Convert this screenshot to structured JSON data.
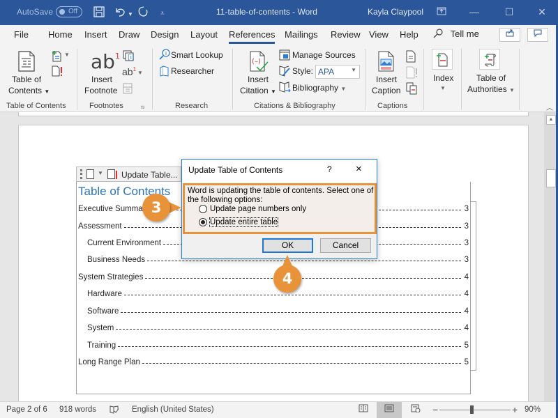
{
  "titlebar": {
    "autosave_label": "AutoSave",
    "autosave_state": "Off",
    "document_title": "11-table-of-contents - Word",
    "user_name": "Kayla Claypool",
    "icons": [
      "save-icon",
      "undo-icon",
      "redo-icon",
      "customize-qat-icon",
      "ribbon-display-icon",
      "minimize-icon",
      "maximize-icon",
      "close-icon"
    ]
  },
  "menu": {
    "tabs": [
      {
        "label": "File"
      },
      {
        "label": "Home"
      },
      {
        "label": "Insert"
      },
      {
        "label": "Draw"
      },
      {
        "label": "Design"
      },
      {
        "label": "Layout"
      },
      {
        "label": "References",
        "active": true
      },
      {
        "label": "Mailings"
      },
      {
        "label": "Review"
      },
      {
        "label": "View"
      },
      {
        "label": "Help"
      }
    ],
    "tell_me": "Tell me",
    "accent_color": "#2b579a"
  },
  "ribbon": {
    "groups": [
      {
        "label": "Table of Contents",
        "buttons": [
          {
            "label_line1": "Table of",
            "label_line2": "Contents",
            "dropdown": true,
            "icon": "table-of-contents-icon"
          },
          {
            "icon": "add-text-icon",
            "dropdown": true
          },
          {
            "icon": "update-table-icon"
          }
        ]
      },
      {
        "label": "Footnotes",
        "buttons": [
          {
            "label_line1": "Insert",
            "label_line2": "Footnote",
            "icon": "insert-footnote-icon"
          },
          {
            "icon": "insert-endnote-icon"
          },
          {
            "icon": "next-footnote-icon",
            "dropdown": true
          },
          {
            "icon": "show-notes-icon",
            "disabled": true
          }
        ]
      },
      {
        "label": "Research",
        "buttons": [
          {
            "label": "Smart Lookup",
            "icon": "smart-lookup-icon"
          },
          {
            "label": "Researcher",
            "icon": "researcher-icon"
          }
        ]
      },
      {
        "label": "Citations & Bibliography",
        "buttons": [
          {
            "label_line1": "Insert",
            "label_line2": "Citation",
            "dropdown": true,
            "icon": "insert-citation-icon"
          },
          {
            "label": "Manage Sources",
            "icon": "manage-sources-icon"
          },
          {
            "label": "Style:",
            "value": "APA",
            "icon": "style-icon"
          },
          {
            "label": "Bibliography",
            "dropdown": true,
            "icon": "bibliography-icon"
          }
        ]
      },
      {
        "label": "Captions",
        "buttons": [
          {
            "label_line1": "Insert",
            "label_line2": "Caption",
            "icon": "insert-caption-icon"
          },
          {
            "icon": "insert-table-of-figures-icon"
          },
          {
            "icon": "update-table-of-figures-icon",
            "disabled": true
          },
          {
            "icon": "cross-reference-icon"
          }
        ]
      },
      {
        "label": "",
        "buttons": [
          {
            "label_line1": "Index",
            "dropdown": true,
            "icon": "index-icon"
          }
        ]
      },
      {
        "label": "",
        "buttons": [
          {
            "label_line1": "Table of",
            "label_line2": "Authorities",
            "dropdown": true,
            "icon": "table-of-authorities-icon"
          }
        ]
      }
    ]
  },
  "document": {
    "toc_toolbar": {
      "update_label": "Update Table..."
    },
    "toc_title": "Table of Contents",
    "entries": [
      {
        "text": "Executive Summary",
        "visible_text": "Executive Summa",
        "page": "3",
        "level": 1
      },
      {
        "text": "Assessment",
        "page": "3",
        "level": 1
      },
      {
        "text": "Current Environment",
        "page": "3",
        "level": 2
      },
      {
        "text": "Business Needs",
        "page": "3",
        "level": 2
      },
      {
        "text": "System Strategies",
        "page": "4",
        "level": 1
      },
      {
        "text": "Hardware",
        "page": "4",
        "level": 2
      },
      {
        "text": "Software",
        "page": "4",
        "level": 2
      },
      {
        "text": "System",
        "page": "4",
        "level": 2
      },
      {
        "text": "Training",
        "page": "5",
        "level": 2
      },
      {
        "text": "Long Range Plan",
        "page": "5",
        "level": 1
      }
    ],
    "heading_color": "#2e74b5"
  },
  "dialog": {
    "title": "Update Table of Contents",
    "help": "?",
    "close": "×",
    "message": "Word is updating the table of contents.  Select one of the following options:",
    "options": [
      {
        "label": "Update page numbers only",
        "checked": false
      },
      {
        "label": "Update entire table",
        "checked": true
      }
    ],
    "ok_label": "OK",
    "cancel_label": "Cancel",
    "highlight_color": "#e8923a"
  },
  "callouts": [
    {
      "number": "3",
      "target": "dialog-options"
    },
    {
      "number": "4",
      "target": "ok-button"
    }
  ],
  "statusbar": {
    "page": "Page 2 of 6",
    "words": "918 words",
    "language": "English (United States)",
    "zoom": "90%",
    "zoom_minus": "−",
    "zoom_plus": "+",
    "active_view": "print-layout"
  }
}
